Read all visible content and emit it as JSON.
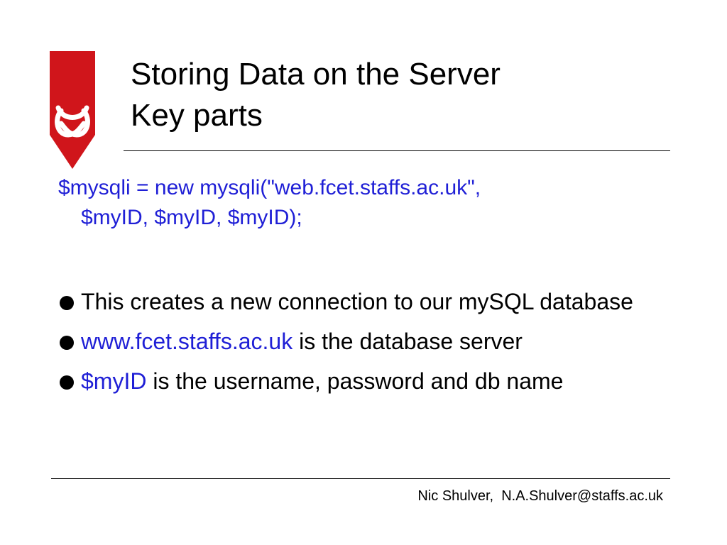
{
  "slide": {
    "title_line1": "Storing Data on the Server",
    "title_line2": "Key parts",
    "code": {
      "line1": "$mysqli = new  mysqli(\"web.fcet.staffs.ac.uk\",",
      "line2": "$myID, $myID, $myID);"
    },
    "bullets": [
      {
        "accent": "",
        "text": "This creates a new connection to our mySQL database"
      },
      {
        "accent": "www.fcet.staffs.ac.uk",
        "text": " is the database server"
      },
      {
        "accent": "$myID",
        "text": " is the username, password and db name"
      }
    ],
    "footer": "Nic Shulver,  N.A.Shulver@staffs.ac.uk"
  },
  "colors": {
    "accent_blue": "#1f1fd6",
    "logo_red": "#d0151b"
  },
  "icons": {
    "logo": "university-crest-icon",
    "bullet": "filled-circle-bullet-icon"
  }
}
